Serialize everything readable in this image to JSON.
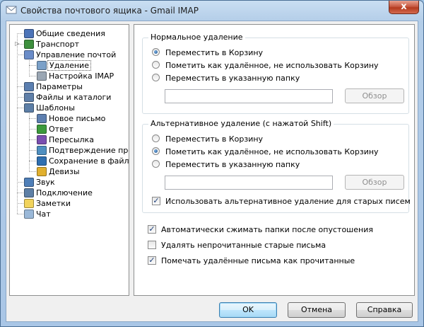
{
  "window": {
    "title": "Свойства почтового ящика - Gmail IMAP",
    "close_glyph": "x"
  },
  "tree": {
    "items": [
      {
        "label": "Общие сведения",
        "icon": "general-info-icon",
        "color": "#4c74b8"
      },
      {
        "label": "Транспорт",
        "icon": "transport-icon",
        "color": "#3d8f3d"
      },
      {
        "label": "Управление почтой",
        "icon": "mail-management-icon",
        "color": "#6a8cc8"
      },
      {
        "label": "Удаление",
        "icon": "delete-bin-icon",
        "color": "#7aa0c8",
        "selected": true
      },
      {
        "label": "Настройка IMAP",
        "icon": "imap-settings-icon",
        "color": "#9aa6b3"
      },
      {
        "label": "Параметры",
        "icon": "parameters-icon",
        "color": "#5b7fb0"
      },
      {
        "label": "Файлы и каталоги",
        "icon": "files-folders-icon",
        "color": "#5f7fa8"
      },
      {
        "label": "Шаблоны",
        "icon": "templates-icon",
        "color": "#5c7ea6"
      },
      {
        "label": "Новое письмо",
        "icon": "new-message-icon",
        "color": "#5d7fb0"
      },
      {
        "label": "Ответ",
        "icon": "reply-icon",
        "color": "#3c9a3c"
      },
      {
        "label": "Пересылка",
        "icon": "forward-icon",
        "color": "#7a4fb0"
      },
      {
        "label": "Подтверждение прочтения",
        "icon": "read-receipt-icon",
        "color": "#4f8fc0"
      },
      {
        "label": "Сохранение в файл",
        "icon": "save-to-file-icon",
        "color": "#2f6fb0"
      },
      {
        "label": "Девизы",
        "icon": "mottos-icon",
        "color": "#e1b02e"
      },
      {
        "label": "Звук",
        "icon": "sound-icon",
        "color": "#4f7fb8"
      },
      {
        "label": "Подключение",
        "icon": "connection-icon",
        "color": "#5d7fa6"
      },
      {
        "label": "Заметки",
        "icon": "notes-icon",
        "color": "#f1d35c"
      },
      {
        "label": "Чат",
        "icon": "chat-icon",
        "color": "#9ab8d8"
      }
    ]
  },
  "normal_delete": {
    "title": "Нормальное удаление",
    "options": [
      "Переместить в Корзину",
      "Пометить как удалённое, не использовать Корзину",
      "Переместить в указанную папку"
    ],
    "selected": 0,
    "folder_value": "",
    "browse_label": "Обзор"
  },
  "alt_delete": {
    "title": "Альтернативное удаление (с нажатой Shift)",
    "options": [
      "Переместить в Корзину",
      "Пометить как удалённое, не использовать Корзину",
      "Переместить в указанную папку"
    ],
    "selected": 1,
    "folder_value": "",
    "browse_label": "Обзор",
    "old_messages_label": "Использовать альтернативное удаление для старых писем",
    "old_messages_checked": true
  },
  "options": {
    "compress_label": "Автоматически сжимать папки после опустошения",
    "compress_checked": true,
    "delete_unread_label": "Удалять непрочитанные старые письма",
    "delete_unread_checked": false,
    "mark_read_label": "Помечать удалённые письма как прочитанные",
    "mark_read_checked": true
  },
  "buttons": {
    "ok": "OK",
    "cancel": "Отмена",
    "help": "Справка"
  }
}
